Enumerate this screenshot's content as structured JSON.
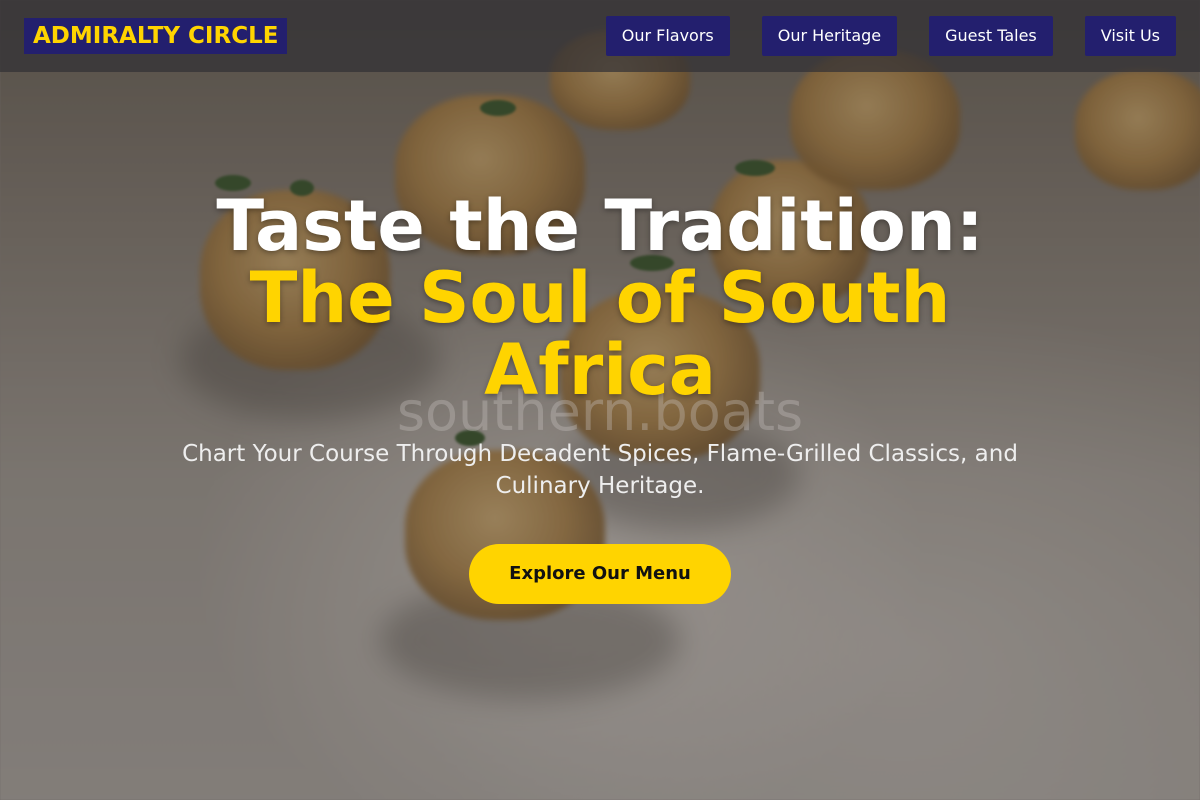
{
  "header": {
    "brand": "ADMIRALTY CIRCLE",
    "nav": [
      {
        "label": "Our Flavors"
      },
      {
        "label": "Our Heritage"
      },
      {
        "label": "Guest Tales"
      },
      {
        "label": "Visit Us"
      }
    ]
  },
  "hero": {
    "title_line1": "Taste the Tradition:",
    "title_accent": "The Soul of South Africa",
    "watermark": "southern.boats",
    "subtitle": "Chart Your Course Through Decadent Spices, Flame-Grilled Classics, and Culinary Heritage.",
    "cta_label": "Explore Our Menu"
  },
  "colors": {
    "brand_navy": "#231f6e",
    "accent_yellow": "#ffd400",
    "header_bg": "rgba(50,48,52,0.72)"
  }
}
